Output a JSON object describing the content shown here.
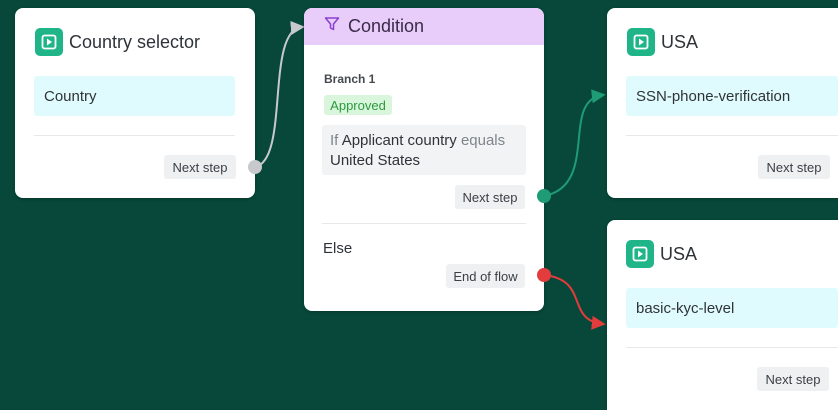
{
  "colors": {
    "canvas": "#07483a",
    "accent_green": "#1fb589",
    "condition_header": "#e8ccf9",
    "connector_grey": "#c7c9cd",
    "connector_teal": "#1f9c76",
    "connector_red": "#e23c3c"
  },
  "nodes": {
    "country_selector": {
      "icon": "play-icon",
      "title": "Country selector",
      "field": "Country",
      "next_step": "Next step"
    },
    "condition": {
      "icon": "filter-icon",
      "title": "Condition",
      "branch_label": "Branch 1",
      "status": "Approved",
      "rule": {
        "if": "If",
        "subject": "Applicant country",
        "operator": "equals",
        "value": "United States"
      },
      "next_step": "Next step",
      "else_label": "Else",
      "end_of_flow": "End of flow"
    },
    "usa_top": {
      "icon": "play-icon",
      "title": "USA",
      "field": "SSN-phone-verification",
      "next_step": "Next step"
    },
    "usa_bottom": {
      "icon": "play-icon",
      "title": "USA",
      "field": "basic-kyc-level",
      "next_step": "Next step"
    }
  }
}
